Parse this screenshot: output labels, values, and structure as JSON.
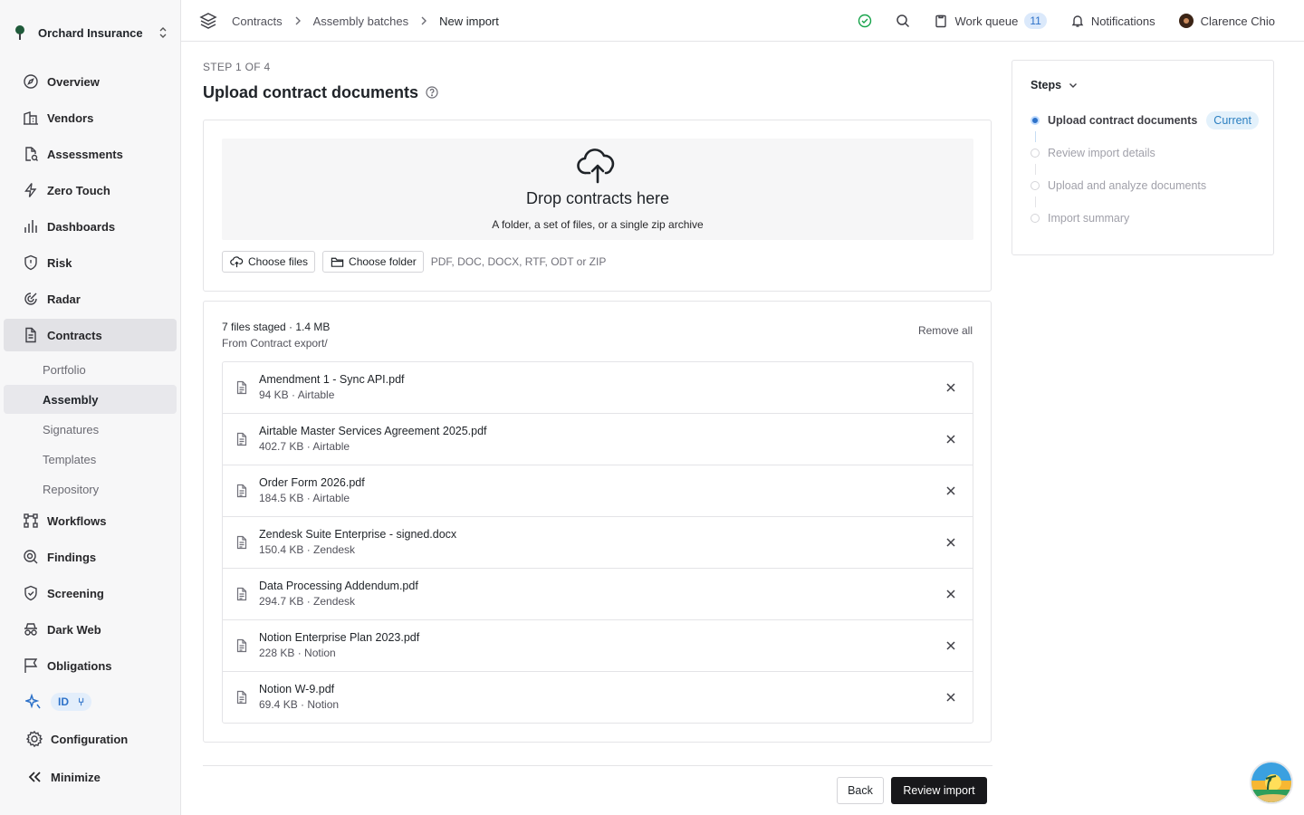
{
  "org": {
    "name": "Orchard Insurance",
    "icon": "tree-icon"
  },
  "nav": {
    "overview": "Overview",
    "vendors": "Vendors",
    "assessments": "Assessments",
    "zero_touch": "Zero Touch",
    "dashboards": "Dashboards",
    "risk": "Risk",
    "radar": "Radar",
    "contracts": "Contracts",
    "sub": {
      "portfolio": "Portfolio",
      "assembly": "Assembly",
      "signatures": "Signatures",
      "templates": "Templates",
      "repository": "Repository"
    },
    "workflows": "Workflows",
    "findings": "Findings",
    "screening": "Screening",
    "dark_web": "Dark Web",
    "obligations": "Obligations",
    "id_badge": "ID",
    "configuration": "Configuration",
    "minimize": "Minimize"
  },
  "breadcrumb": [
    "Contracts",
    "Assembly batches",
    "New import"
  ],
  "topbar": {
    "work_queue": "Work queue",
    "work_queue_count": "11",
    "notifications": "Notifications",
    "user": "Clarence Chio"
  },
  "page": {
    "step_label": "STEP 1 OF 4",
    "title": "Upload contract documents"
  },
  "dropzone": {
    "title": "Drop contracts here",
    "subtitle": "A folder, a set of files, or a single zip archive",
    "choose_files": "Choose files",
    "choose_folder": "Choose folder",
    "formats": "PDF, DOC, DOCX, RTF, ODT or ZIP"
  },
  "staged": {
    "count": "7 files staged · 1.4 MB",
    "source": "From Contract export/",
    "remove_all": "Remove all",
    "files": [
      {
        "name": "Amendment 1 - Sync API.pdf",
        "meta": "94 KB · Airtable"
      },
      {
        "name": "Airtable Master Services Agreement 2025.pdf",
        "meta": "402.7 KB · Airtable"
      },
      {
        "name": "Order Form 2026.pdf",
        "meta": "184.5 KB · Airtable"
      },
      {
        "name": "Zendesk Suite Enterprise - signed.docx",
        "meta": "150.4 KB · Zendesk"
      },
      {
        "name": "Data Processing Addendum.pdf",
        "meta": "294.7 KB · Zendesk"
      },
      {
        "name": "Notion Enterprise Plan 2023.pdf",
        "meta": "228 KB · Notion"
      },
      {
        "name": "Notion W-9.pdf",
        "meta": "69.4 KB · Notion"
      }
    ]
  },
  "footer": {
    "back": "Back",
    "primary": "Review import"
  },
  "steps": {
    "title": "Steps",
    "current_badge": "Current",
    "items": [
      "Upload contract documents",
      "Review import details",
      "Upload and analyze documents",
      "Import summary"
    ]
  },
  "colors": {
    "accent": "#2e72c9",
    "primary_button": "#18181b",
    "active_nav": "#e2e2e6"
  }
}
